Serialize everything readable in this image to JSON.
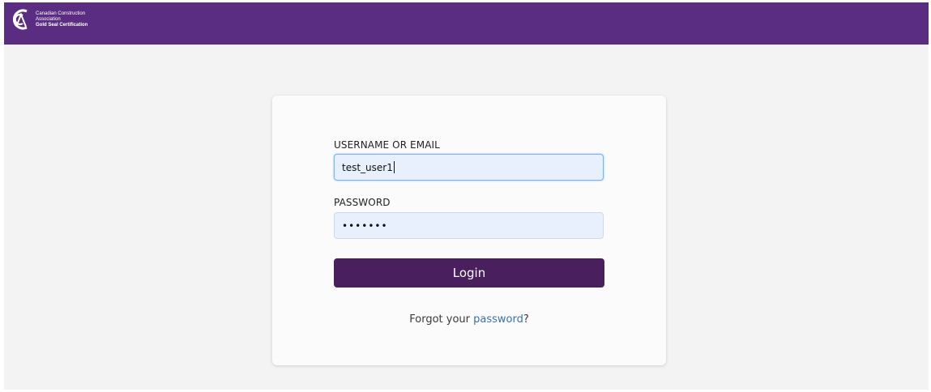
{
  "header": {
    "logo": {
      "line1": "Canadian Construction",
      "line2": "Association",
      "line3": "Gold Seal Certification"
    }
  },
  "login": {
    "username_label": "USERNAME OR EMAIL",
    "username_value": "test_user1",
    "password_label": "PASSWORD",
    "password_value": "•••••••",
    "login_button": "Login",
    "forgot_prefix": "Forgot your ",
    "forgot_link": "password",
    "forgot_suffix": "?"
  },
  "colors": {
    "header_bg": "#5a2d82",
    "button_bg": "#4a1f5e",
    "link": "#3c6fb4",
    "input_bg": "#e8f0fe"
  },
  "icons": {
    "logo": "cca-logo-icon"
  }
}
